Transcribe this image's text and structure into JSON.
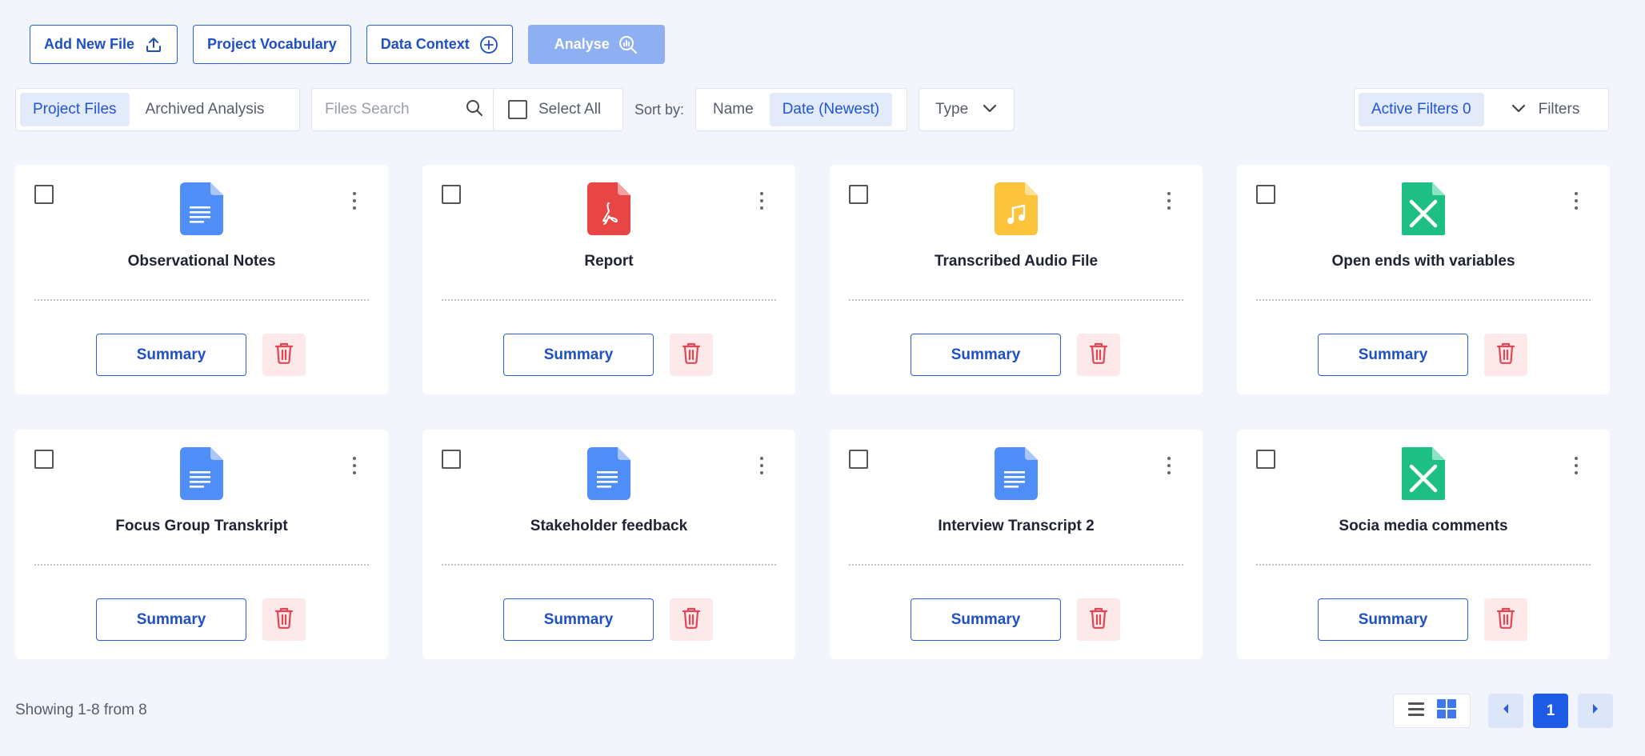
{
  "actions": {
    "add_file": "Add New File",
    "vocabulary": "Project Vocabulary",
    "data_context": "Data Context",
    "analyse": "Analyse"
  },
  "tabs": [
    {
      "label": "Project Files",
      "active": true
    },
    {
      "label": "Archived Analysis",
      "active": false
    }
  ],
  "search": {
    "placeholder": "Files Search",
    "value": ""
  },
  "select_all": "Select All",
  "sort": {
    "label": "Sort by:",
    "options": [
      {
        "label": "Name",
        "active": false
      },
      {
        "label": "Date (Newest)",
        "active": true
      }
    ]
  },
  "type_dropdown": "Type",
  "filters": {
    "active_label": "Active Filters 0",
    "button": "Filters"
  },
  "files": [
    {
      "name": "Observational Notes",
      "icon": "doc",
      "summary": "Summary"
    },
    {
      "name": "Report",
      "icon": "pdf",
      "summary": "Summary"
    },
    {
      "name": "Transcribed Audio File",
      "icon": "audio",
      "summary": "Summary"
    },
    {
      "name": "Open ends with variables",
      "icon": "sheet",
      "summary": "Summary"
    },
    {
      "name": "Focus Group Transkript",
      "icon": "doc",
      "summary": "Summary"
    },
    {
      "name": "Stakeholder feedback",
      "icon": "doc",
      "summary": "Summary"
    },
    {
      "name": "Interview Transcript 2",
      "icon": "doc",
      "summary": "Summary"
    },
    {
      "name": "Socia media comments",
      "icon": "sheet",
      "summary": "Summary"
    }
  ],
  "footer": {
    "showing": "Showing 1-8 from 8",
    "current_page": "1"
  },
  "colors": {
    "accent": "#1d5ae6",
    "doc": "#4f8ef7",
    "pdf": "#e84545",
    "audio": "#fbc43c",
    "sheet": "#1dbf84",
    "delete_bg": "#fde8ea",
    "delete_icon": "#e04654"
  }
}
